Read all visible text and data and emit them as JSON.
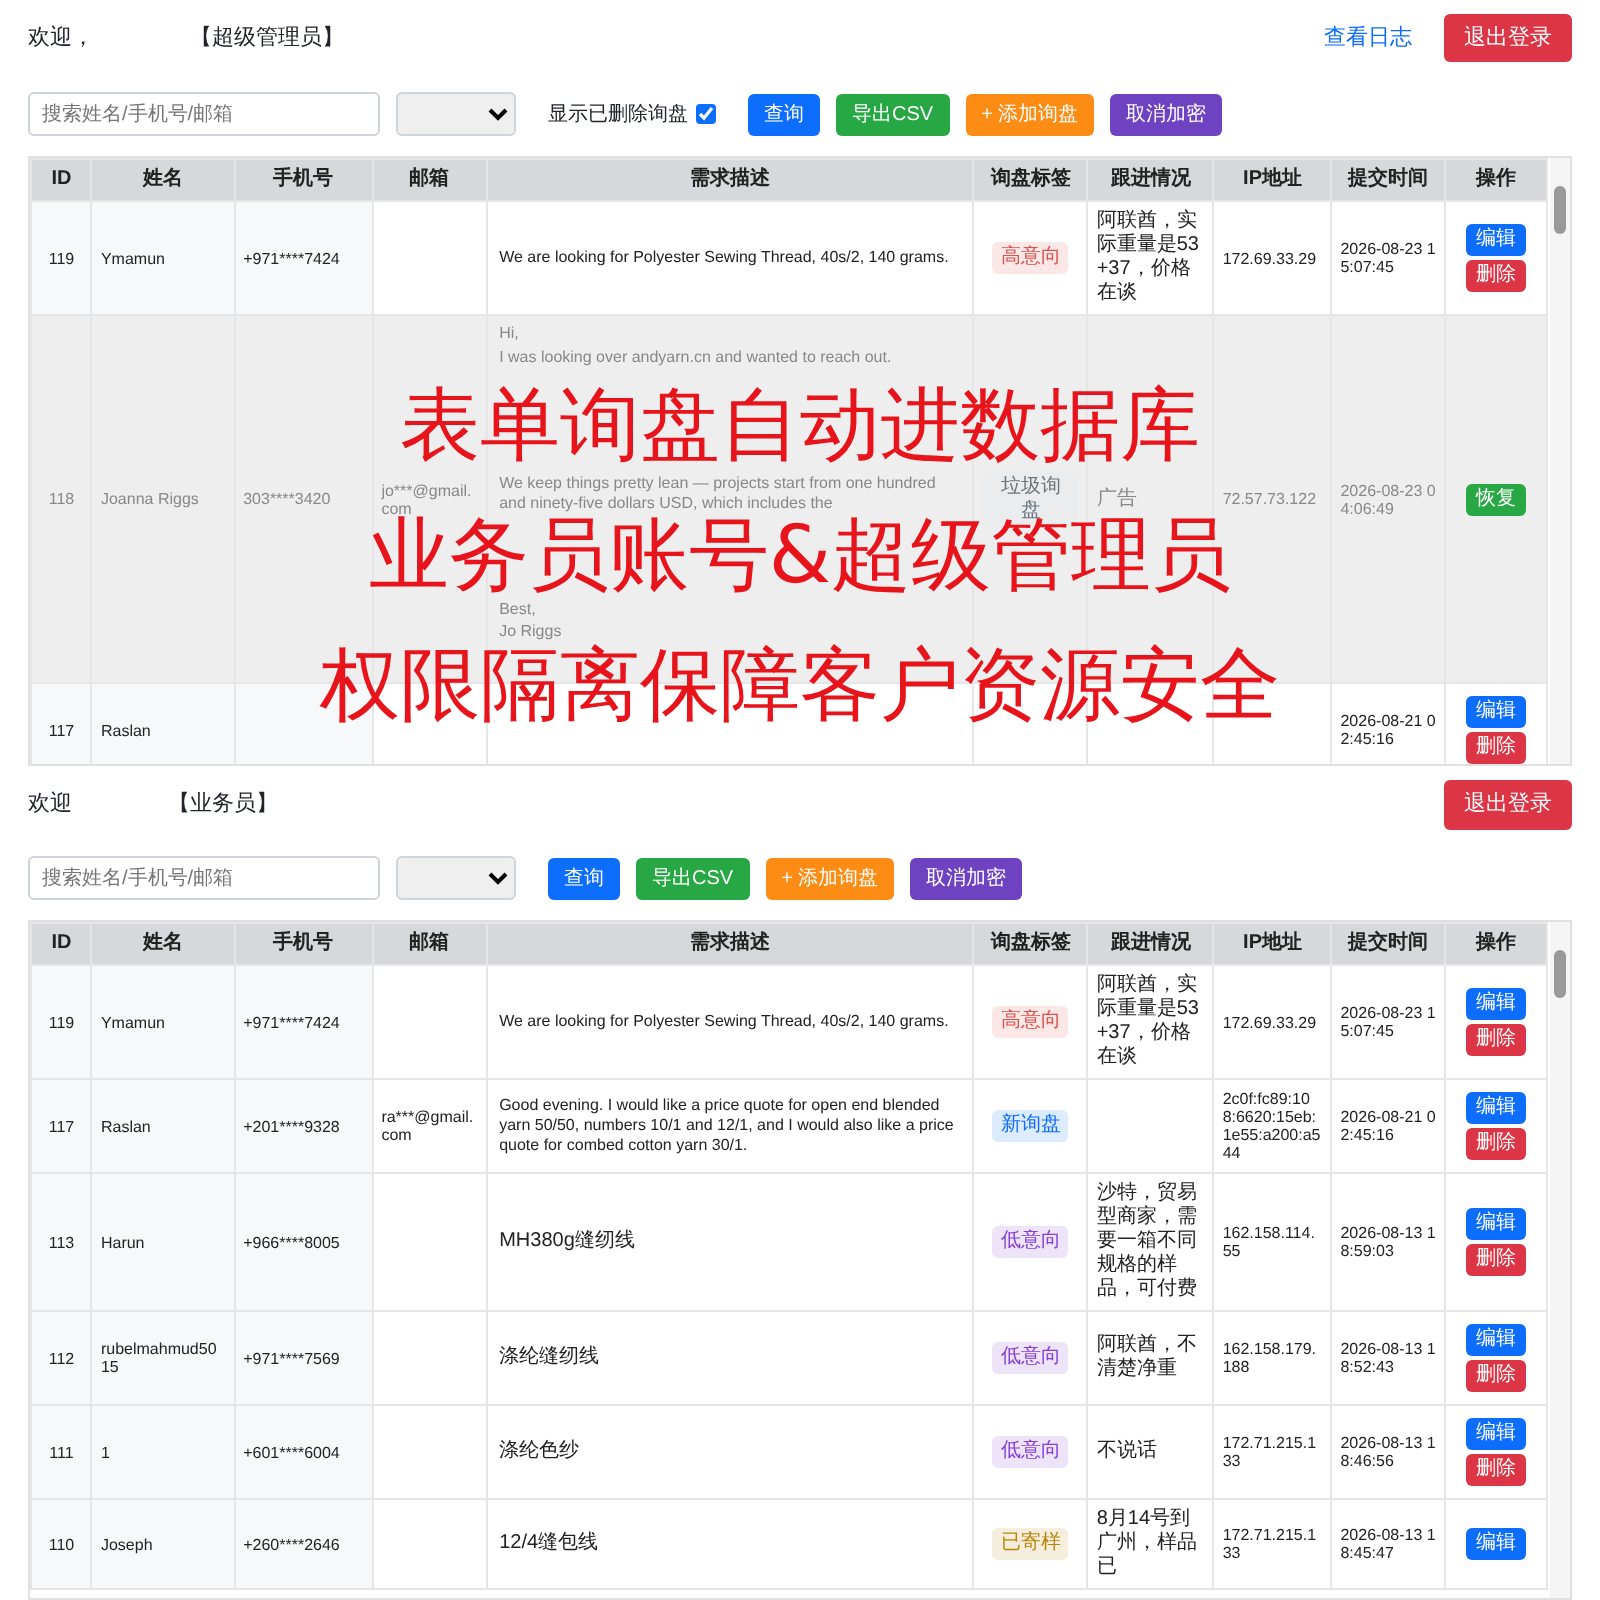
{
  "panels": [
    {
      "welcome": "欢迎，",
      "role": "【超级管理员】",
      "log_link": "查看日志",
      "logout": "退出登录",
      "search": {
        "placeholder": "搜索姓名/手机号/邮箱"
      },
      "show_deleted": {
        "label": "显示已删除询盘",
        "checked": true
      },
      "buttons": [
        {
          "label": "查询",
          "kind": "query"
        },
        {
          "label": "导出CSV",
          "kind": "export"
        },
        {
          "label": "+ 添加询盘",
          "kind": "add"
        },
        {
          "label": "取消加密",
          "kind": "decrypt"
        }
      ],
      "columns": [
        "ID",
        "姓名",
        "手机号",
        "邮箱",
        "需求描述",
        "询盘标签",
        "跟进情况",
        "IP地址",
        "提交时间",
        "操作"
      ],
      "rows": [
        {
          "id": "119",
          "name": "Ymamun",
          "phone": "+971****7424",
          "description": [
            "We are looking for Polyester Sewing Thread, 40s/2, 140 grams."
          ],
          "tag": {
            "label": "高意向",
            "color": "#d9534f"
          },
          "followup": "阿联酋，实际重量是53+37，价格在谈",
          "ip": "172.69.33.29",
          "submitted": "2026-08-23 15:07:45",
          "deleted": false,
          "actions": [
            {
              "label": "编辑",
              "kind": "edit"
            },
            {
              "label": "删除",
              "kind": "delete"
            }
          ]
        },
        {
          "id": "118",
          "name": "Joanna Riggs",
          "phone": "303****3420",
          "email": "jo***@gmail.com",
          "description": [
            "Hi,",
            "I was looking over andyarn.cn and wanted to reach out.",
            "We keep things pretty lean — projects start from one hundred and ninety-five dollars USD, which includes the",
            "Best,",
            "Jo Riggs"
          ],
          "tag": {
            "label": "垃圾询盘",
            "color": "#6c757d"
          },
          "followup": "广告",
          "ip": "72.57.73.122",
          "submitted": "2026-08-23 04:06:49",
          "deleted": true,
          "actions": [
            {
              "label": "恢复",
              "kind": "restore"
            }
          ]
        },
        {
          "id": "117",
          "name": "Raslan",
          "submitted": "2026-08-21 02:45:16",
          "deleted": false,
          "actions": [
            {
              "label": "编辑",
              "kind": "edit"
            },
            {
              "label": "删除",
              "kind": "delete"
            }
          ]
        }
      ],
      "banner_lines": [
        "表单询盘自动进数据库",
        "业务员账号&超级管理员",
        "权限隔离保障客户资源安全"
      ]
    },
    {
      "welcome": "欢迎",
      "role": "【业务员】",
      "logout": "退出登录",
      "search": {
        "placeholder": "搜索姓名/手机号/邮箱"
      },
      "buttons": [
        {
          "label": "查询",
          "kind": "query"
        },
        {
          "label": "导出CSV",
          "kind": "export"
        },
        {
          "label": "+ 添加询盘",
          "kind": "add"
        },
        {
          "label": "取消加密",
          "kind": "decrypt"
        }
      ],
      "columns": [
        "ID",
        "姓名",
        "手机号",
        "邮箱",
        "需求描述",
        "询盘标签",
        "跟进情况",
        "IP地址",
        "提交时间",
        "操作"
      ],
      "rows": [
        {
          "id": "119",
          "name": "Ymamun",
          "phone": "+971****7424",
          "description": [
            "We are looking for Polyester Sewing Thread, 40s/2, 140 grams."
          ],
          "tag": {
            "label": "高意向",
            "color": "#d9534f"
          },
          "followup": "阿联酋，实际重量是53+37，价格在谈",
          "ip": "172.69.33.29",
          "submitted": "2026-08-23 15:07:45",
          "deleted": false,
          "actions": [
            {
              "label": "编辑",
              "kind": "edit"
            },
            {
              "label": "删除",
              "kind": "delete"
            }
          ]
        },
        {
          "id": "117",
          "name": "Raslan",
          "phone": "+201****9328",
          "email": "ra***@gmail.com",
          "description": [
            "Good evening. I would like a price quote for open end blended yarn 50/50, numbers 10/1 and 12/1, and I would also like a price quote for combed cotton yarn 30/1."
          ],
          "tag": {
            "label": "新询盘",
            "color": "#0d6efd"
          },
          "ip": "2c0f:fc89:108:6620:15eb:1e55:a200:a544",
          "submitted": "2026-08-21 02:45:16",
          "deleted": false,
          "actions": [
            {
              "label": "编辑",
              "kind": "edit"
            },
            {
              "label": "删除",
              "kind": "delete"
            }
          ]
        },
        {
          "id": "113",
          "name": "Harun",
          "phone": "+966****8005",
          "description": [
            "MH380g缝纫线"
          ],
          "tag": {
            "label": "低意向",
            "color": "#8540d6"
          },
          "followup": "沙特，贸易型商家，需要一箱不同规格的样品，可付费",
          "ip": "162.158.114.55",
          "submitted": "2026-08-13 18:59:03",
          "deleted": false,
          "actions": [
            {
              "label": "编辑",
              "kind": "edit"
            },
            {
              "label": "删除",
              "kind": "delete"
            }
          ]
        },
        {
          "id": "112",
          "name": "rubelmahmud5015",
          "phone": "+971****7569",
          "description": [
            "涤纶缝纫线"
          ],
          "tag": {
            "label": "低意向",
            "color": "#8540d6"
          },
          "followup": "阿联酋，不清楚净重",
          "ip": "162.158.179.188",
          "submitted": "2026-08-13 18:52:43",
          "deleted": false,
          "actions": [
            {
              "label": "编辑",
              "kind": "edit"
            },
            {
              "label": "删除",
              "kind": "delete"
            }
          ]
        },
        {
          "id": "111",
          "name": "1",
          "phone": "+601****6004",
          "description": [
            "涤纶色纱"
          ],
          "tag": {
            "label": "低意向",
            "color": "#8540d6"
          },
          "followup": "不说话",
          "ip": "172.71.215.133",
          "submitted": "2026-08-13 18:46:56",
          "deleted": false,
          "actions": [
            {
              "label": "编辑",
              "kind": "edit"
            },
            {
              "label": "删除",
              "kind": "delete"
            }
          ]
        },
        {
          "id": "110",
          "name": "Joseph",
          "phone": "+260****2646",
          "description": [
            "12/4缝包线"
          ],
          "tag": {
            "label": "已寄样",
            "color": "#b8860b"
          },
          "followup": "8月14号到广州，样品已",
          "ip": "172.71.215.133",
          "submitted": "2026-08-13 18:45:47",
          "deleted": false,
          "actions": [
            {
              "label": "编辑",
              "kind": "edit"
            }
          ]
        }
      ]
    }
  ]
}
